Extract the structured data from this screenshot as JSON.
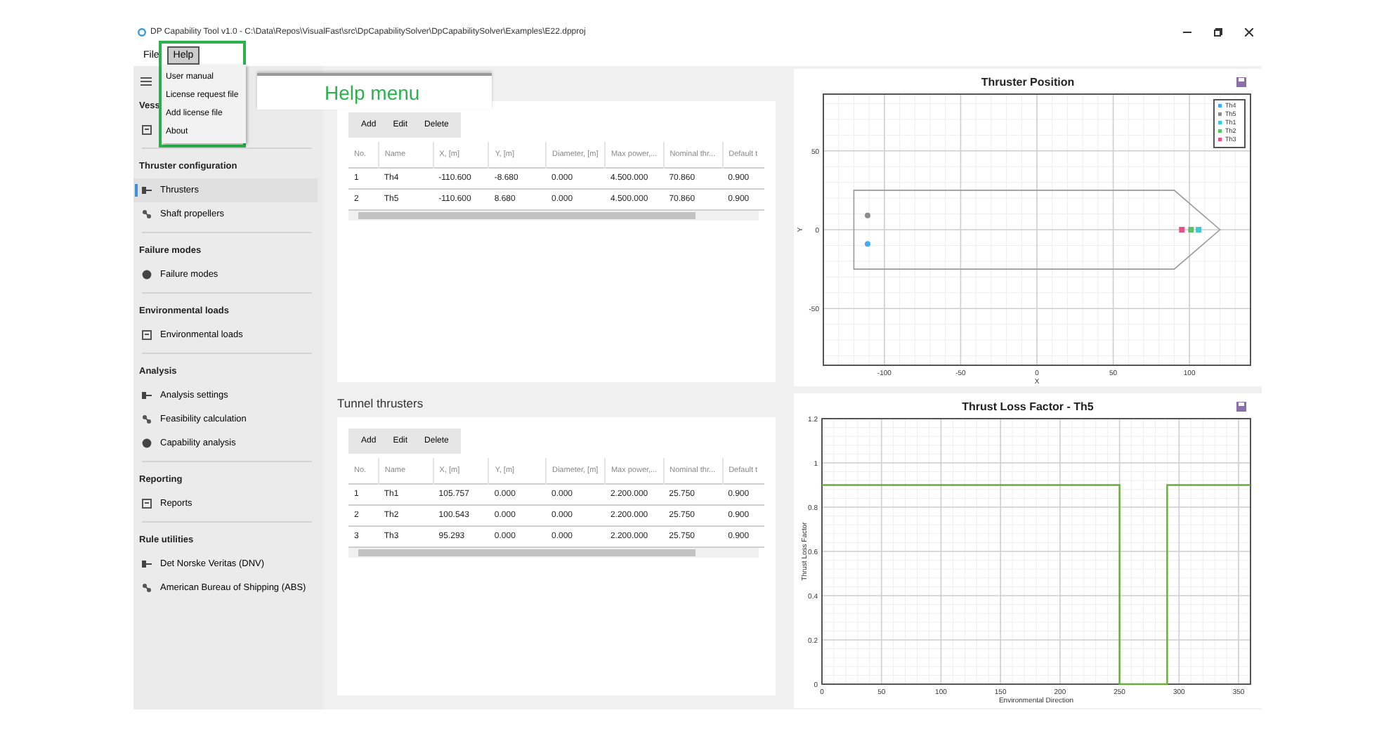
{
  "window": {
    "title": "DP Capability Tool v1.0 - C:\\Data\\Repos\\VisualFast\\src\\DpCapabilitySolver\\DpCapabilitySolver\\Examples\\E22.dpproj"
  },
  "menu_bar": [
    {
      "label": "File",
      "selected": false
    },
    {
      "label": "Help",
      "selected": true
    }
  ],
  "help_menu": {
    "items": [
      "User manual",
      "License request file",
      "Add license file",
      "About"
    ]
  },
  "annotation": {
    "label": "Help menu"
  },
  "sidebar": {
    "sections": [
      {
        "title": "Vess",
        "items": [
          {
            "selected": false
          }
        ]
      },
      {
        "title": "Thruster configuration",
        "items": [
          {
            "label": "Thrusters",
            "selected": true
          },
          {
            "label": "Shaft propellers",
            "selected": false
          }
        ]
      },
      {
        "title": "Failure modes",
        "items": [
          {
            "label": "Failure modes",
            "selected": false
          }
        ]
      },
      {
        "title": "Environmental loads",
        "items": [
          {
            "label": "Environmental loads",
            "selected": false
          }
        ]
      },
      {
        "title": "Analysis",
        "items": [
          {
            "label": "Analysis settings",
            "selected": false
          },
          {
            "label": "Feasibility calculation",
            "selected": false
          },
          {
            "label": "Capability analysis",
            "selected": false
          }
        ]
      },
      {
        "title": "Reporting",
        "items": [
          {
            "label": "Reports",
            "selected": false
          }
        ]
      },
      {
        "title": "Rule utilities",
        "items": [
          {
            "label": "Det Norske Veritas (DNV)",
            "selected": false
          },
          {
            "label": "American Bureau of Shipping (ABS)",
            "selected": false
          }
        ]
      }
    ]
  },
  "azimuth_thrusters": {
    "toolbar": [
      "Add",
      "Edit",
      "Delete"
    ],
    "table": {
      "columns": [
        "No.",
        "Name",
        "X, [m]",
        "Y, [m]",
        "Diameter, [m]",
        "Max power,...",
        "Nominal thr...",
        "Default t"
      ],
      "rows": [
        [
          "1",
          "Th4",
          "-110.600",
          "-8.680",
          "0.000",
          "4.500.000",
          "70.860",
          "0.900"
        ],
        [
          "2",
          "Th5",
          "-110.600",
          "8.680",
          "0.000",
          "4.500.000",
          "70.860",
          "0.900"
        ]
      ]
    }
  },
  "tunnel_thrusters": {
    "title": "Tunnel thrusters",
    "toolbar": [
      "Add",
      "Edit",
      "Delete"
    ],
    "table": {
      "columns": [
        "No.",
        "Name",
        "X, [m]",
        "Y, [m]",
        "Diameter, [m]",
        "Max power,...",
        "Nominal thr...",
        "Default t"
      ],
      "rows": [
        [
          "1",
          "Th1",
          "105.757",
          "0.000",
          "0.000",
          "2.200.000",
          "25.750",
          "0.900"
        ],
        [
          "2",
          "Th2",
          "100.543",
          "0.000",
          "0.000",
          "2.200.000",
          "25.750",
          "0.900"
        ],
        [
          "3",
          "Th3",
          "95.293",
          "0.000",
          "0.000",
          "2.200.000",
          "25.750",
          "0.900"
        ]
      ]
    }
  },
  "thruster_position": {
    "title": "Thruster Position",
    "chart_data": {
      "type": "scatter",
      "grid": true,
      "legend": true,
      "xlabel": "X",
      "ylabel": "Y",
      "xlim": [
        -140,
        140
      ],
      "ylim": [
        -86,
        86
      ],
      "xticks": [
        -100,
        -50,
        0,
        50,
        100
      ],
      "yticks": [
        -50,
        0,
        50
      ],
      "series": [
        {
          "name": "Th4",
          "color": "#4aa8f0",
          "marker": "circle",
          "x": [
            -111
          ],
          "values": [
            -9
          ]
        },
        {
          "name": "Th5",
          "color": "#8c8c8c",
          "marker": "circle",
          "x": [
            -111
          ],
          "values": [
            9
          ]
        },
        {
          "name": "Th1",
          "color": "#3cc8d8",
          "marker": "square",
          "x": [
            106
          ],
          "values": [
            0
          ]
        },
        {
          "name": "Th2",
          "color": "#5cbf6a",
          "marker": "square",
          "x": [
            101
          ],
          "values": [
            0
          ]
        },
        {
          "name": "Th3",
          "color": "#e8508a",
          "marker": "square",
          "x": [
            95
          ],
          "values": [
            0
          ]
        }
      ]
    }
  },
  "thrust_loss": {
    "title": "Thrust Loss Factor - Th5",
    "chart_data": {
      "type": "line",
      "grid": true,
      "xlabel": "Environmental Direction",
      "ylabel": "Thrust Loss Factor",
      "xlim": [
        0,
        360
      ],
      "ylim": [
        0,
        1.2
      ],
      "xticks": [
        0,
        50,
        100,
        150,
        200,
        250,
        300,
        350
      ],
      "yticks": [
        0,
        0.2,
        0.4,
        0.6,
        0.8,
        1,
        1.2
      ],
      "x": [
        0,
        250,
        250,
        290,
        290,
        360
      ],
      "series": [
        {
          "color": "#6aaa3a",
          "values": [
            0.9,
            0.9,
            0,
            0,
            0.9,
            0.9
          ]
        }
      ]
    }
  }
}
